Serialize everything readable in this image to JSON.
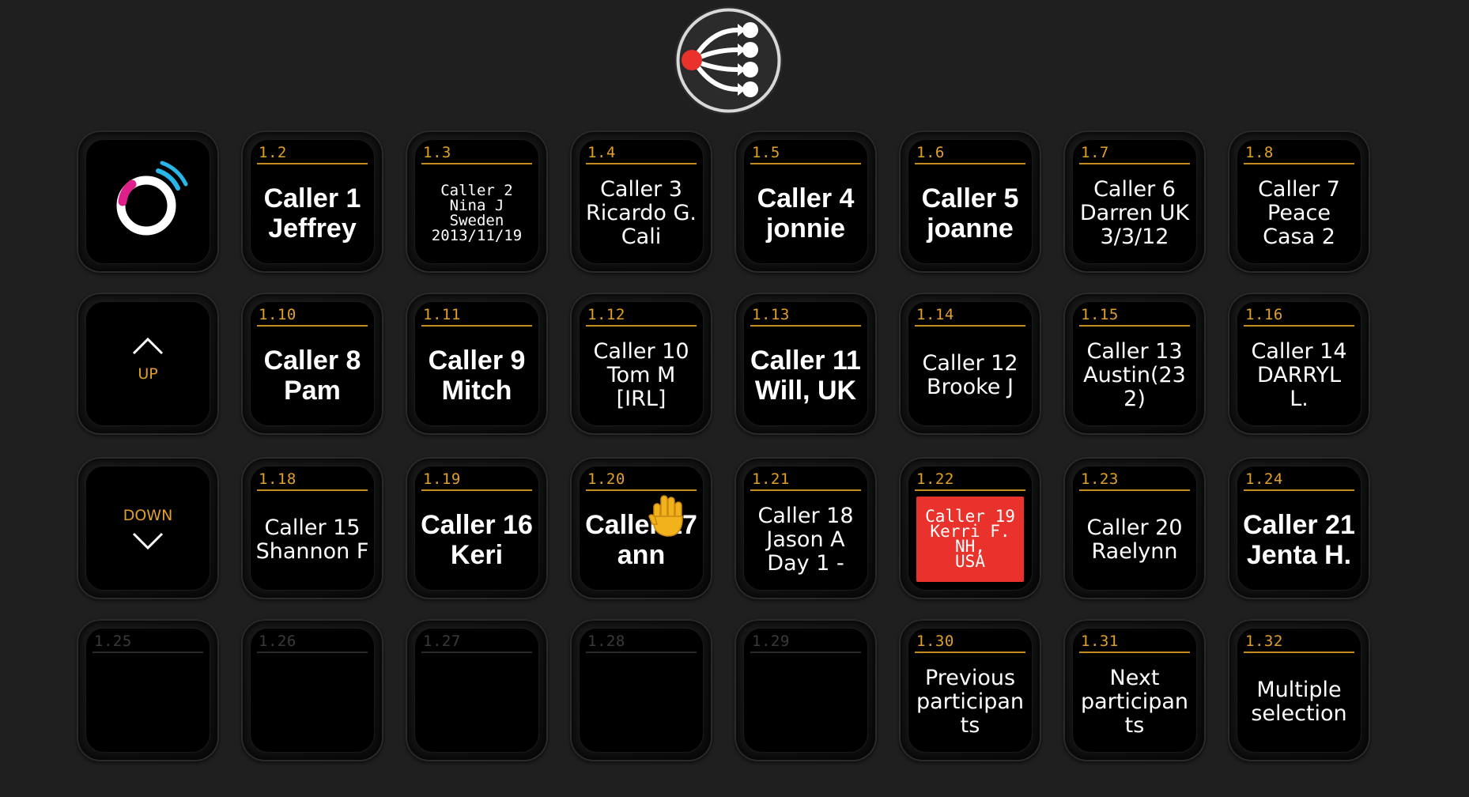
{
  "app": {
    "top_logo_icon": "share-routing-icon",
    "brand_logo_icon": "circle-signal-logo-icon"
  },
  "nav": {
    "up_label": "UP",
    "down_label": "DOWN"
  },
  "colors": {
    "accent": "#e0a02a",
    "active_red": "#e8322b",
    "background": "#1f1f1f"
  },
  "keys": [
    {
      "id": "1.2",
      "lines": "Caller 1\nJeffrey",
      "style": "big"
    },
    {
      "id": "1.3",
      "lines": "Caller 2\nNina J\nSweden\n2013/11/19",
      "style": "small"
    },
    {
      "id": "1.4",
      "lines": "Caller 3\nRicardo G.\nCali",
      "style": "mid"
    },
    {
      "id": "1.5",
      "lines": "Caller 4\njonnie",
      "style": "big"
    },
    {
      "id": "1.6",
      "lines": "Caller 5\njoanne",
      "style": "big"
    },
    {
      "id": "1.7",
      "lines": "Caller 6\nDarren UK\n3/3/12",
      "style": "mid"
    },
    {
      "id": "1.8",
      "lines": "Caller 7\nPeace\nCasa 2",
      "style": "mid"
    },
    {
      "id": "1.10",
      "lines": "Caller 8\nPam",
      "style": "big"
    },
    {
      "id": "1.11",
      "lines": "Caller 9\nMitch",
      "style": "big"
    },
    {
      "id": "1.12",
      "lines": "Caller 10\nTom M\n[IRL]",
      "style": "mid"
    },
    {
      "id": "1.13",
      "lines": "Caller 11\nWill, UK",
      "style": "big"
    },
    {
      "id": "1.14",
      "lines": "Caller 12\nBrooke J",
      "style": "mid"
    },
    {
      "id": "1.15",
      "lines": "Caller 13\nAustin(23\n2)",
      "style": "mid"
    },
    {
      "id": "1.16",
      "lines": "Caller 14\nDARRYL\nL.",
      "style": "mid"
    },
    {
      "id": "1.18",
      "lines": "Caller 15\nShannon F",
      "style": "mid"
    },
    {
      "id": "1.19",
      "lines": "Caller 16\nKeri",
      "style": "big"
    },
    {
      "id": "1.20",
      "lines": "Caller 17\nann",
      "style": "big",
      "raised_hand": true
    },
    {
      "id": "1.21",
      "lines": "Caller 18\nJason A\nDay 1 -",
      "style": "mid"
    },
    {
      "id": "1.22",
      "lines": "Caller 19\nKerri F. NH,\nUSA",
      "style": "small2",
      "active": true
    },
    {
      "id": "1.23",
      "lines": "Caller 20\nRaelynn",
      "style": "mid"
    },
    {
      "id": "1.24",
      "lines": "Caller 21\nJenta H.",
      "style": "big"
    },
    {
      "id": "1.25",
      "lines": "",
      "style": "mid",
      "empty": true
    },
    {
      "id": "1.26",
      "lines": "",
      "style": "mid",
      "empty": true
    },
    {
      "id": "1.27",
      "lines": "",
      "style": "mid",
      "empty": true
    },
    {
      "id": "1.28",
      "lines": "",
      "style": "mid",
      "empty": true
    },
    {
      "id": "1.29",
      "lines": "",
      "style": "mid",
      "empty": true
    },
    {
      "id": "1.30",
      "lines": "Previous\nparticipan\nts",
      "style": "mid"
    },
    {
      "id": "1.31",
      "lines": "Next\nparticipan\nts",
      "style": "mid"
    },
    {
      "id": "1.32",
      "lines": "Multiple\nselection",
      "style": "mid"
    }
  ]
}
